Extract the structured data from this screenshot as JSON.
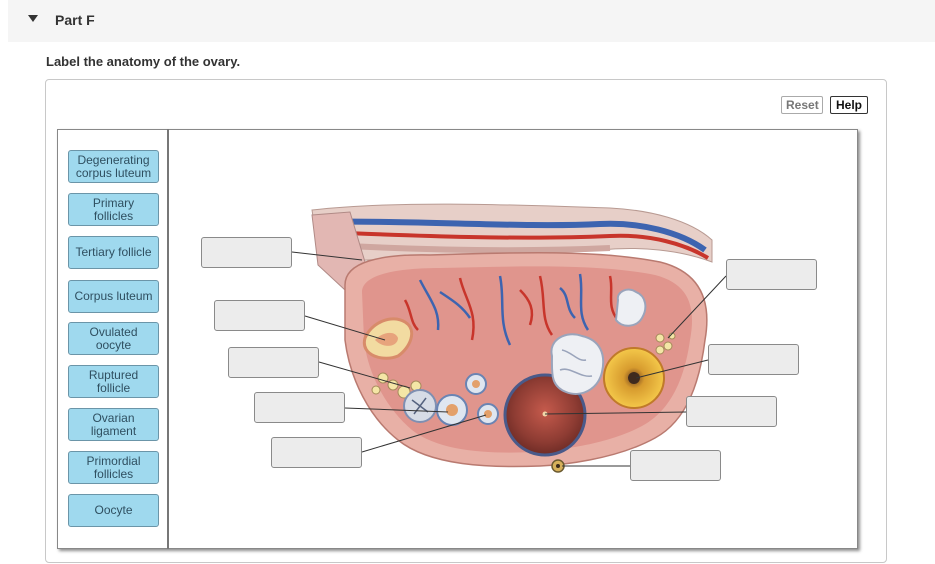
{
  "part": {
    "title": "Part F"
  },
  "question": {
    "instruction": "Label the anatomy of the ovary."
  },
  "toolbar": {
    "reset_label": "Reset",
    "help_label": "Help"
  },
  "labels": [
    "Degenerating\ncorpus luteum",
    "Primary\nfollicles",
    "Tertiary follicle",
    "Corpus luteum",
    "Ovulated\noocyte",
    "Ruptured\nfollicle",
    "Ovarian\nligament",
    "Primordial\nfollicles",
    "Oocyte"
  ],
  "colors": {
    "chip_fill": "#9fd9ee",
    "chip_border": "#6b95a8",
    "drop_fill": "#ececec",
    "header_fill": "#f5f5f5"
  }
}
